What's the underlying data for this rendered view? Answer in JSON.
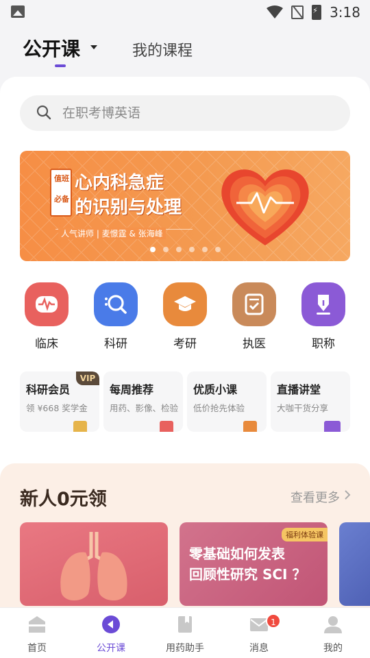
{
  "status_bar": {
    "time": "3:18",
    "icons": [
      "image-icon",
      "wifi-icon",
      "no-sim-icon",
      "battery-charging-icon"
    ]
  },
  "top_tabs": {
    "active": "公开课",
    "second": "我的课程"
  },
  "search": {
    "placeholder": "在职考博英语"
  },
  "banner": {
    "badge": [
      "值班",
      "必备"
    ],
    "title_line1": "心内科急症",
    "title_line2": "的识别与处理",
    "subtitle": "人气讲师 | 麦憬霆 & 张海峰",
    "slide_count": 6,
    "active_slide": 1
  },
  "categories": [
    {
      "label": "临床",
      "icon": "heart-monitor-icon",
      "color": "#e8615e"
    },
    {
      "label": "科研",
      "icon": "magnifier-icon",
      "color": "#4a7be8"
    },
    {
      "label": "考研",
      "icon": "graduation-cap-icon",
      "color": "#e88a3c"
    },
    {
      "label": "执医",
      "icon": "clipboard-check-icon",
      "color": "#c98a5a"
    },
    {
      "label": "职称",
      "icon": "pen-nib-icon",
      "color": "#8b5ad6"
    }
  ],
  "cards": [
    {
      "title": "科研会员",
      "sub": "领 ¥668 奖学金",
      "badge": "VIP"
    },
    {
      "title": "每周推荐",
      "sub": "用药、影像、检验"
    },
    {
      "title": "优质小课",
      "sub": "低价抢先体验"
    },
    {
      "title": "直播讲堂",
      "sub": "大咖干货分享"
    }
  ],
  "promo": {
    "title": "新人0元领",
    "more": "查看更多",
    "course2_tag": "福利体验课",
    "course2_line1": "零基础如何发表",
    "course2_line2": "回顾性研究 SCI ？"
  },
  "bottom_nav": [
    {
      "label": "首页",
      "icon": "home-icon"
    },
    {
      "label": "公开课",
      "icon": "play-circle-icon",
      "active": true
    },
    {
      "label": "用药助手",
      "icon": "book-icon"
    },
    {
      "label": "消息",
      "icon": "mail-icon",
      "badge": "1"
    },
    {
      "label": "我的",
      "icon": "person-icon"
    }
  ],
  "colors": {
    "accent": "#6b4bd6",
    "promo_bg": "#fcefe6",
    "banner": "#f68e45"
  }
}
